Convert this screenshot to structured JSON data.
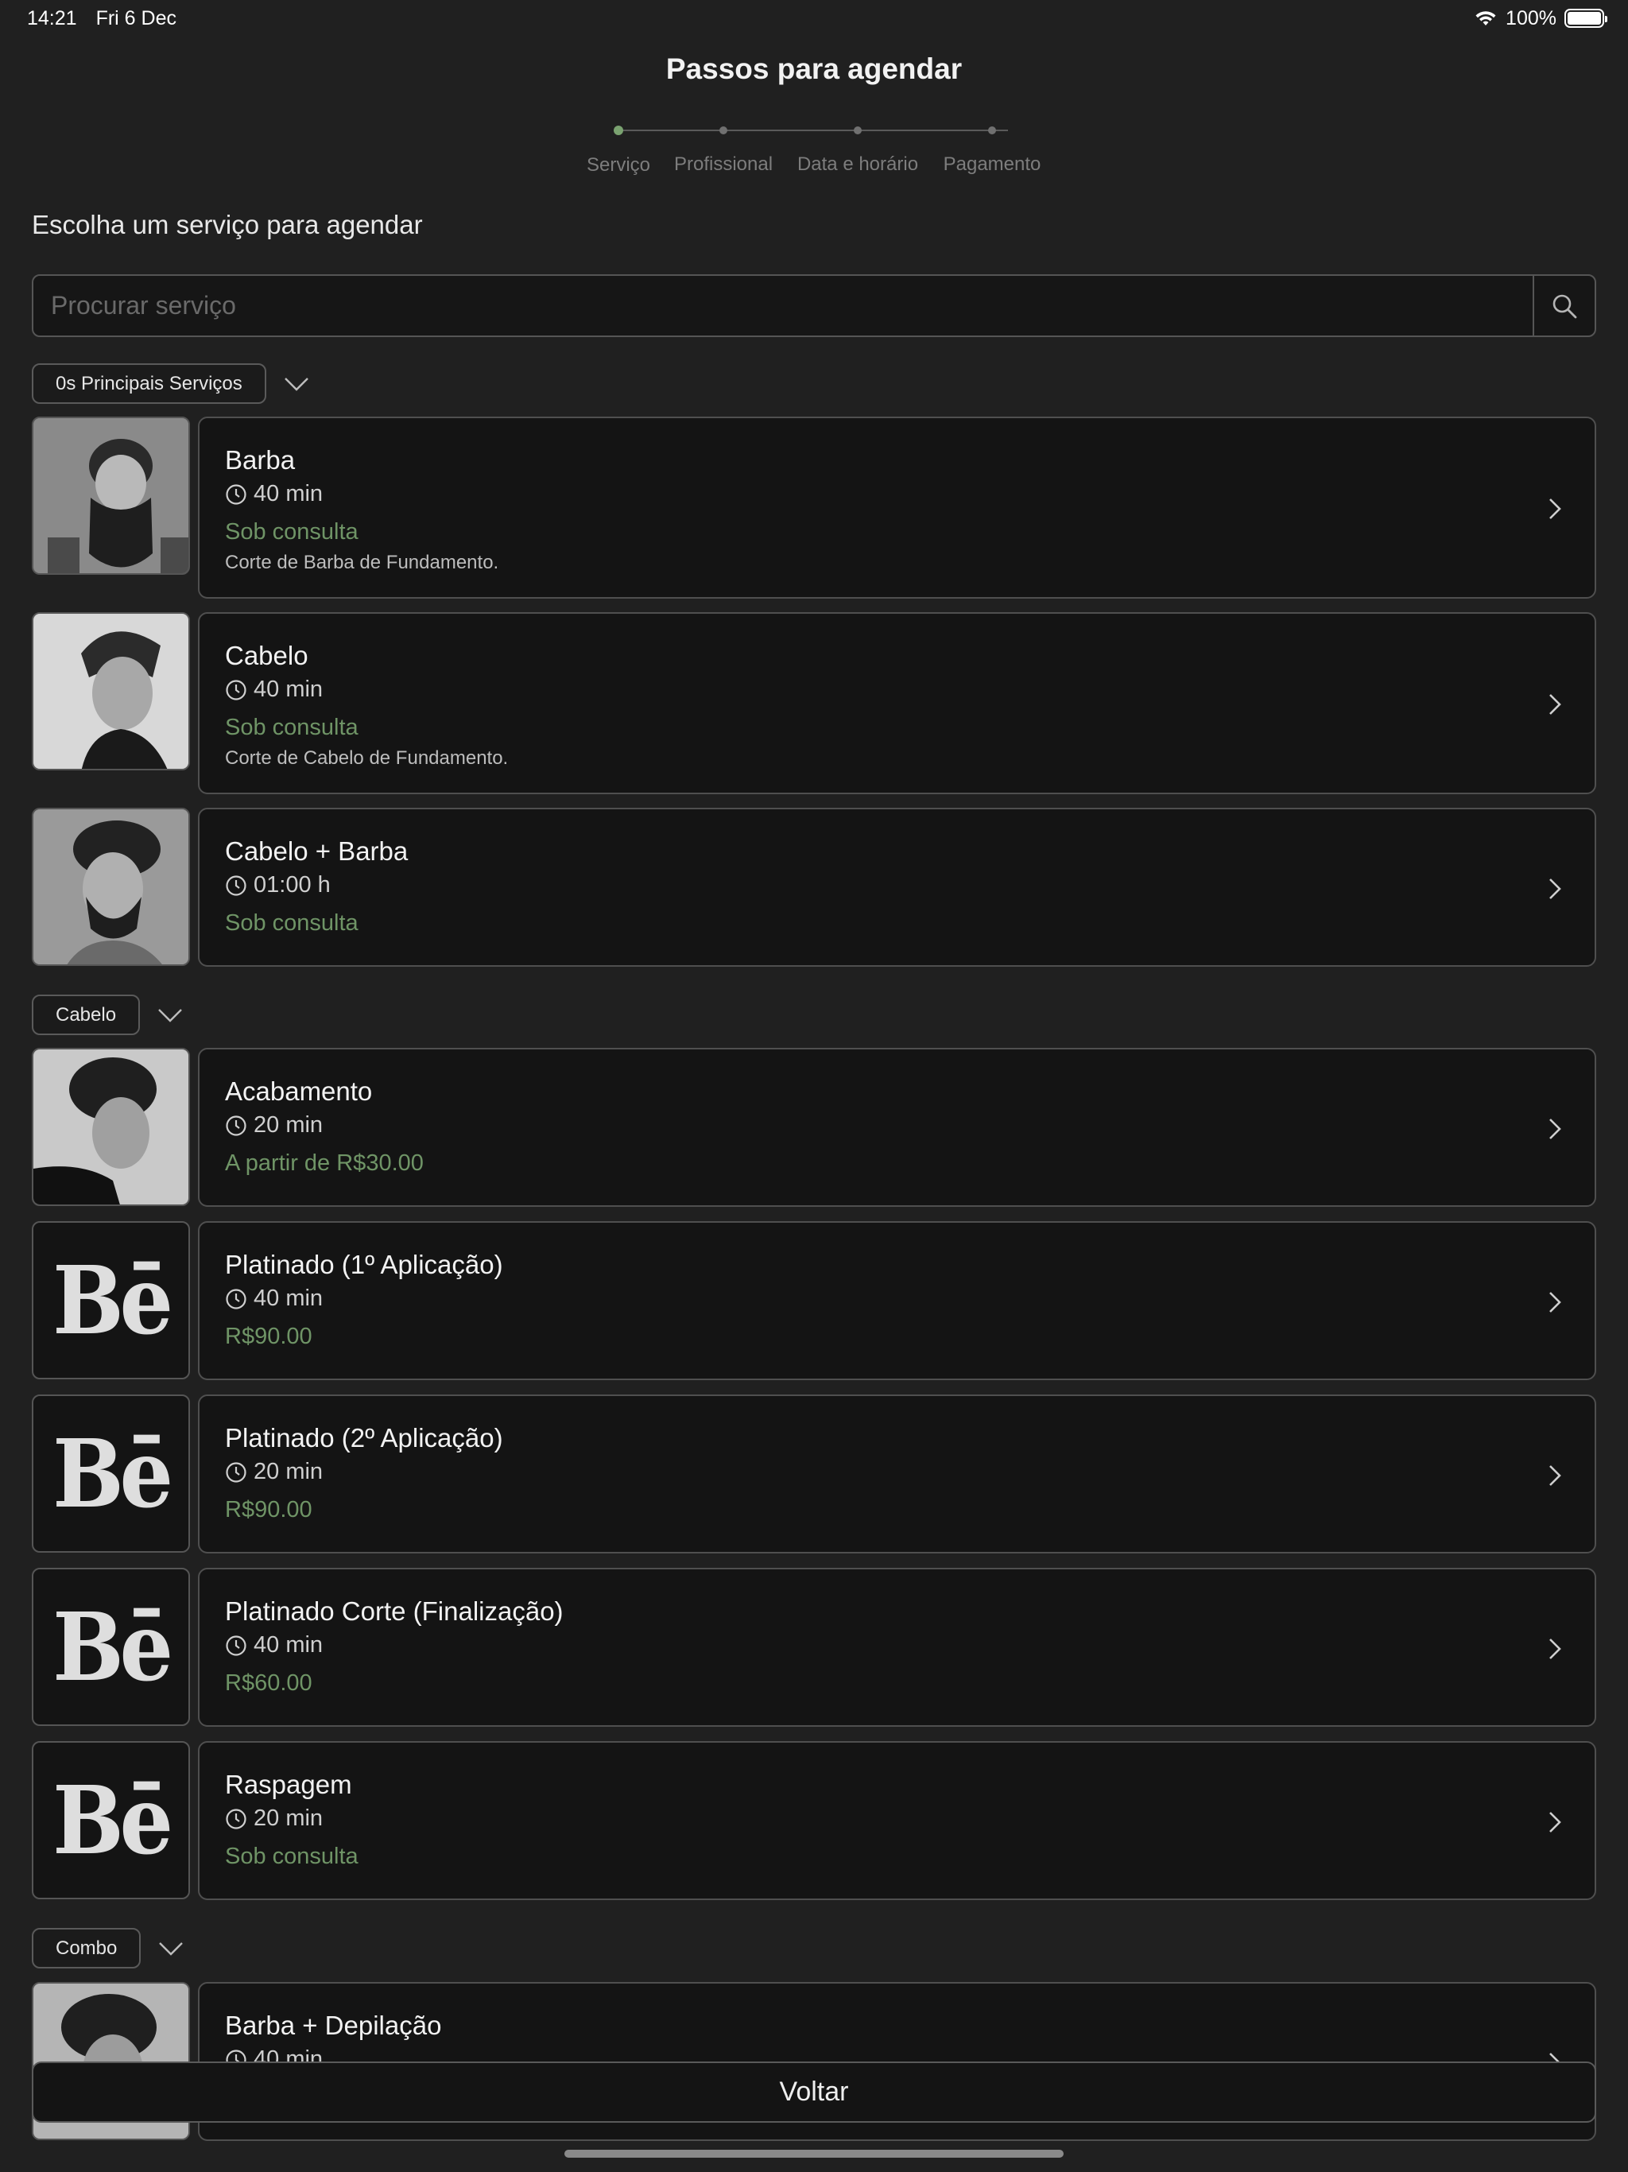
{
  "status_bar": {
    "time": "14:21",
    "date": "Fri 6 Dec",
    "battery": "100%"
  },
  "page": {
    "title": "Passos para agendar",
    "steps": [
      "Serviço",
      "Profissional",
      "Data e horário",
      "Pagamento"
    ],
    "active_step": 0,
    "heading": "Escolha um serviço para agendar"
  },
  "search": {
    "placeholder": "Procurar serviço"
  },
  "categories": [
    {
      "label": "0s Principais Serviços",
      "services": [
        {
          "name": "Barba",
          "duration": "40 min",
          "price": "Sob consulta",
          "description": "Corte de Barba de Fundamento.",
          "image": "man-with-long-beard-photo"
        },
        {
          "name": "Cabelo",
          "duration": "40 min",
          "price": "Sob consulta",
          "description": "Corte de Cabelo de Fundamento.",
          "image": "man-pompadour-haircut-photo"
        },
        {
          "name": "Cabelo + Barba",
          "duration": "01:00 h",
          "price": "Sob consulta",
          "image": "man-curly-hair-beard-photo"
        }
      ]
    },
    {
      "label": "Cabelo",
      "services": [
        {
          "name": "Acabamento",
          "duration": "20 min",
          "price": "A partir de R$30.00",
          "image": "man-curly-fade-photo"
        },
        {
          "name": "Platinado (1º Aplicação)",
          "duration": "40 min",
          "price": "R$90.00",
          "logo": "Bē"
        },
        {
          "name": "Platinado (2º Aplicação)",
          "duration": "20 min",
          "price": "R$90.00",
          "logo": "Bē"
        },
        {
          "name": "Platinado Corte (Finalização)",
          "duration": "40 min",
          "price": "R$60.00",
          "logo": "Bē"
        },
        {
          "name": "Raspagem",
          "duration": "20 min",
          "price": "Sob consulta",
          "logo": "Bē"
        }
      ]
    },
    {
      "label": "Combo",
      "services": [
        {
          "name": "Barba + Depilação",
          "duration": "40 min",
          "image": "man-curly-hair-photo"
        }
      ]
    }
  ],
  "footer": {
    "back_label": "Voltar"
  },
  "colors": {
    "background": "#202020",
    "card": "#141414",
    "price_green": "#6f9466",
    "active_step": "#7aa270"
  }
}
